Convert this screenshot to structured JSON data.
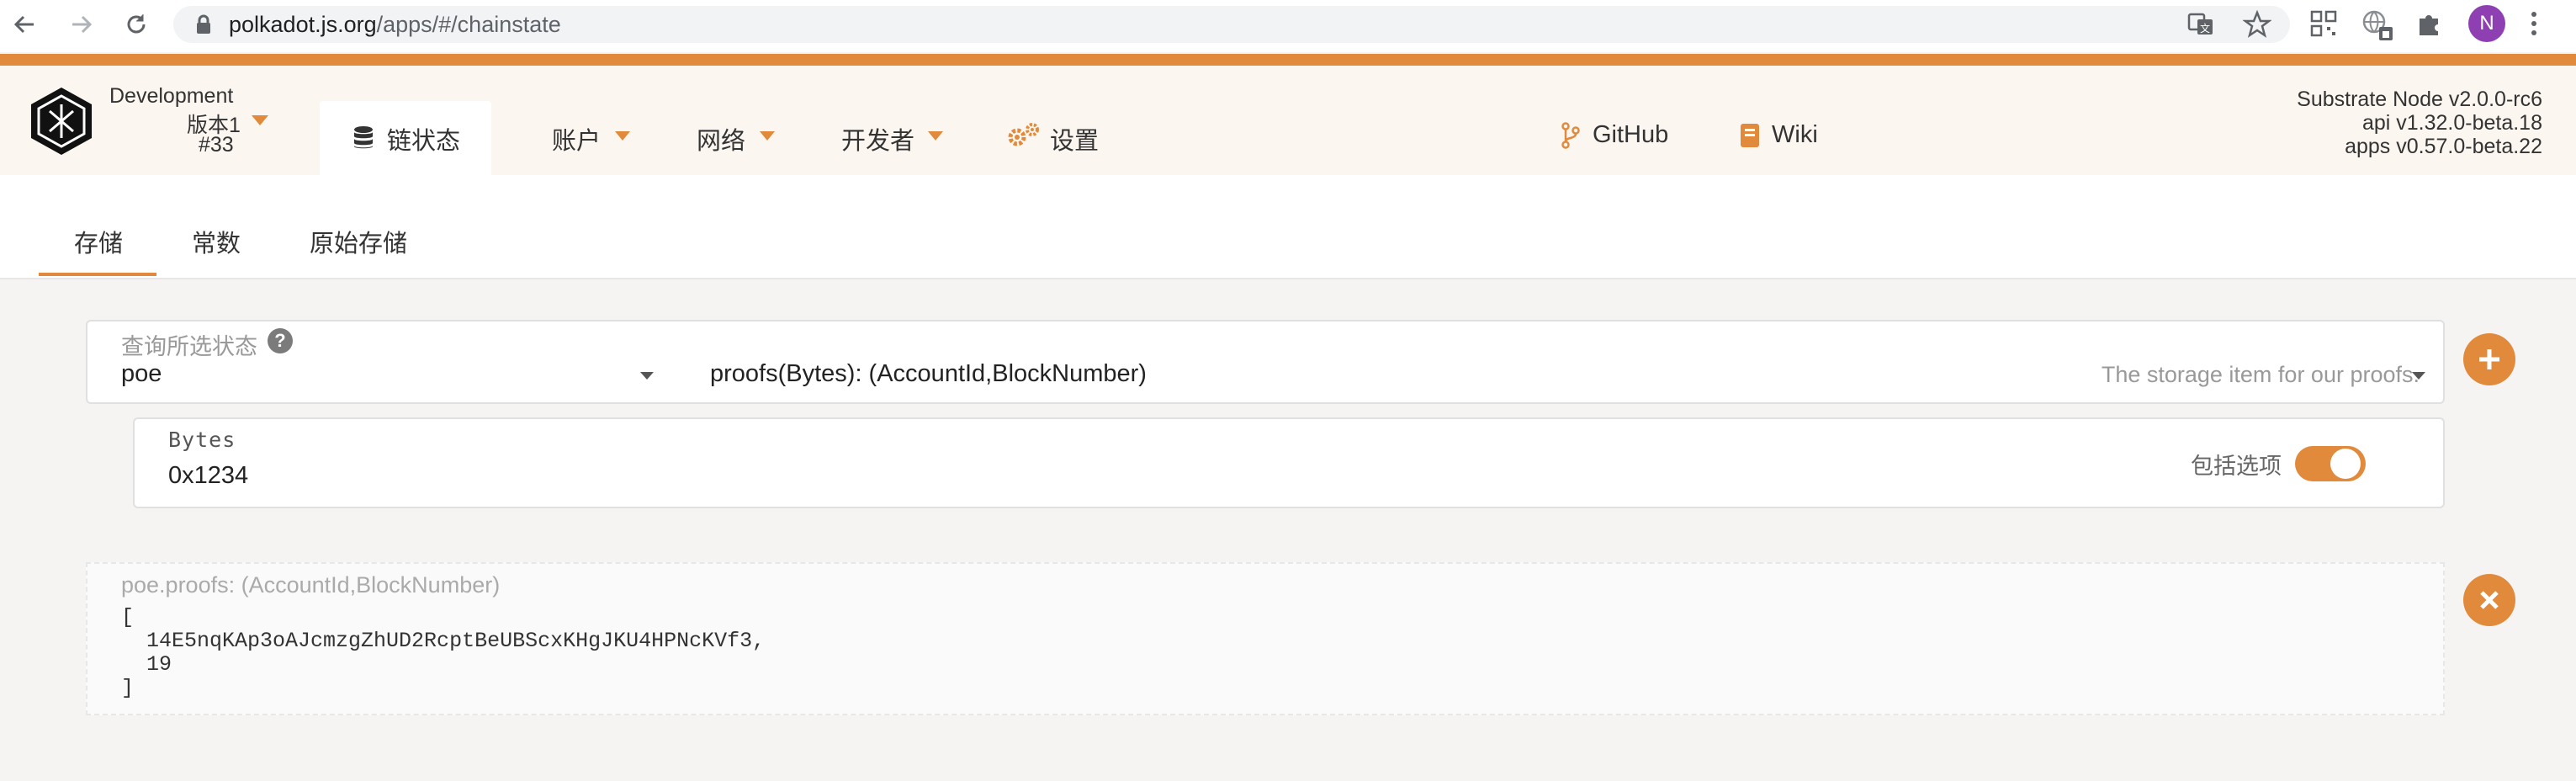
{
  "browser": {
    "url_host": "polkadot.js.org",
    "url_path": "/apps/#/chainstate",
    "avatar_initial": "N",
    "icons": [
      "back-icon",
      "forward-icon",
      "reload-icon",
      "lock-icon",
      "translate-icon",
      "star-icon",
      "qr-icon",
      "network-icon",
      "puzzle-icon",
      "menu-dots-icon"
    ]
  },
  "header": {
    "chain_name": "Development",
    "chain_version": "版本1",
    "chain_block": "#33",
    "nav": {
      "chainstate": "链状态",
      "accounts": "账户",
      "network": "网络",
      "developer": "开发者",
      "settings": "设置",
      "github": "GitHub",
      "wiki": "Wiki"
    },
    "node_info": {
      "node": "Substrate Node v2.0.0-rc6",
      "api": "api v1.32.0-beta.18",
      "apps": "apps v0.57.0-beta.22"
    }
  },
  "subtabs": {
    "storage": "存储",
    "constants": "常数",
    "raw_storage": "原始存储",
    "active": "storage"
  },
  "query": {
    "label": "查询所选状态",
    "module": "poe",
    "method": "proofs(Bytes): (AccountId,BlockNumber)",
    "method_doc": "The storage item for our proofs.",
    "param_label": "Bytes",
    "param_value": "0x1234",
    "toggle_label": "包括选项",
    "toggle_on": true
  },
  "result": {
    "label": "poe.proofs: (AccountId,BlockNumber)",
    "body": "[\n  14E5nqKAp3oAJcmzgZhUD2RcptBeUBScxKHgJKU4HPNcKVf3,\n  19\n]"
  },
  "colors": {
    "accent": "#e18a3c",
    "header_bg": "#fbf6f0",
    "page_bg": "#f5f4f3"
  }
}
